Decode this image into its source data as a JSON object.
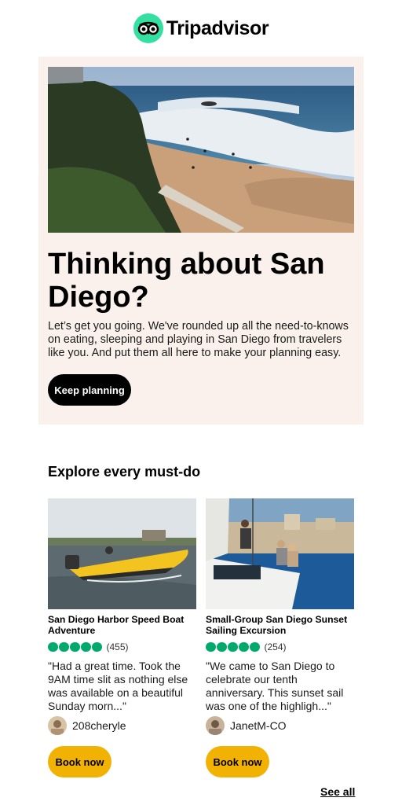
{
  "brand": {
    "name": "Tripadvisor",
    "logo_icon": "owl-icon",
    "logo_color": "#34e0a1"
  },
  "hero": {
    "image_icon": "la-jolla-coast-photo",
    "title": "Thinking about San Diego?",
    "body": "Let’s get you going. We've rounded up all the need-to-knows on eating, sleeping and playing in San Diego from travelers like you. And put them all here to make your planning easy.",
    "button_label": "Keep planning",
    "background": "#faf1ed"
  },
  "section": {
    "title": "Explore every must-do"
  },
  "cards": [
    {
      "image_icon": "speed-boat-photo",
      "title": "San Diego Harbor Speed Boat Adventure",
      "rating_bubbles": 5,
      "review_count": "(455)",
      "quote": "\"Had a great time. Took the 9AM time slit as nothing else was available on a beautiful Sunday morn...\"",
      "username": "208cheryle",
      "button_label": "Book now"
    },
    {
      "image_icon": "sailboat-photo",
      "title": "Small-Group San Diego Sunset Sailing Excursion",
      "rating_bubbles": 5,
      "review_count": "(254)",
      "quote": "\"We came to San Diego to celebrate our tenth anniversary. This sunset sail was one of the highligh...\"",
      "username": "JanetM-CO",
      "button_label": "Book now"
    }
  ],
  "footer": {
    "see_all_label": "See all"
  },
  "colors": {
    "rating": "#00aa6c",
    "book_button": "#f2b203",
    "primary_button": "#000000"
  }
}
